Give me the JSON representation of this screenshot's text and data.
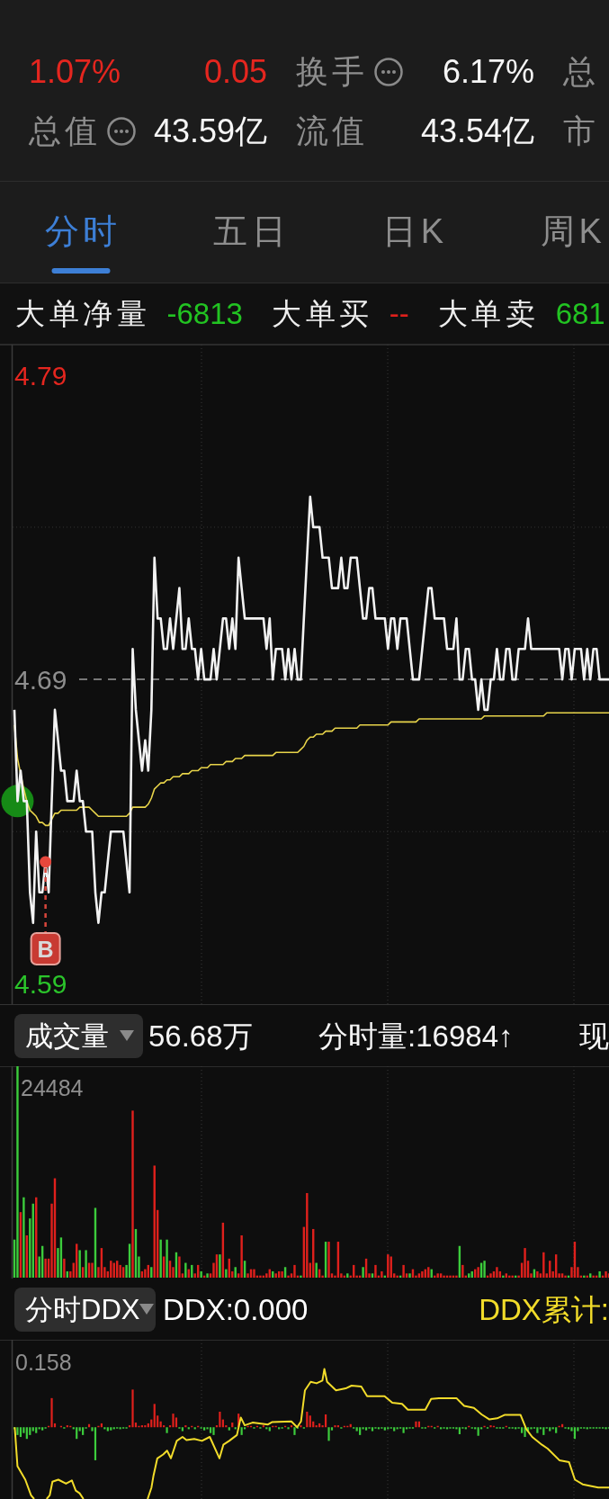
{
  "quote": {
    "change_percent": "1.07%",
    "change": "0.05"
  },
  "stats": [
    {
      "label": "换手",
      "info": true,
      "value": "6.17%"
    },
    {
      "label": "总",
      "info": false
    },
    {
      "label": "总值",
      "info": true,
      "value": "43.59亿"
    },
    {
      "label": "流值",
      "info": false,
      "value": "43.54亿"
    },
    {
      "label": "市",
      "info": false
    }
  ],
  "tabs": [
    {
      "label": "分时",
      "selected": true
    },
    {
      "label": "五日",
      "selected": false
    },
    {
      "label": "日K",
      "selected": false
    },
    {
      "label": "周K",
      "selected": false
    }
  ],
  "big_orders": [
    {
      "label": "大单净量",
      "value": "-6813",
      "color": "#22c322"
    },
    {
      "label": "大单买",
      "value": "--",
      "color": "#e0201c"
    },
    {
      "label": "大单卖",
      "value": "681",
      "color": "#22c322"
    }
  ],
  "price_chart": {
    "chart_data": {
      "type": "line",
      "categories": [
        null,
        null,
        null,
        null,
        null,
        null,
        null,
        null,
        null,
        null,
        null,
        null,
        null,
        null,
        null,
        null,
        null,
        null,
        null,
        null,
        null,
        null,
        null,
        null,
        null,
        null,
        null,
        null,
        null,
        null,
        null,
        null,
        null,
        null,
        null,
        null,
        null,
        null,
        null,
        null,
        null,
        null,
        null,
        null,
        null,
        null,
        null,
        null,
        null,
        null,
        null,
        null,
        null,
        null,
        null,
        null,
        null,
        null,
        null,
        null,
        null,
        null,
        null,
        null,
        null,
        null,
        null,
        null,
        null,
        null,
        null,
        null,
        null,
        null,
        null,
        null,
        null,
        null,
        null,
        null,
        null,
        null,
        null,
        null,
        null,
        null,
        null,
        null,
        null,
        null,
        null,
        null,
        null,
        null,
        null,
        null,
        null,
        null,
        null,
        null,
        null,
        null,
        null,
        null,
        null,
        null,
        null,
        null,
        null,
        null,
        null,
        null,
        null,
        null,
        null,
        null,
        null,
        null,
        null,
        null,
        null,
        null,
        null,
        null,
        null,
        null,
        null,
        null,
        null,
        null,
        null,
        null,
        null,
        null,
        null,
        null,
        null,
        null,
        null,
        null,
        null,
        null,
        null,
        null,
        null,
        null,
        null,
        null,
        null,
        null,
        null,
        null,
        null,
        null,
        null,
        null,
        null,
        null,
        null,
        null,
        null,
        null,
        null,
        null,
        null,
        null,
        null,
        null,
        null,
        null,
        null,
        null,
        null,
        null,
        null,
        null,
        null,
        null,
        null,
        null,
        null,
        null,
        null,
        null,
        null,
        null,
        null,
        null,
        null,
        null,
        null,
        null
      ],
      "ylim": [
        4.583,
        4.8
      ],
      "yticks": [
        {
          "value": 4.79,
          "label": "4.79"
        },
        {
          "value": 4.69,
          "label": "4.69"
        },
        {
          "value": 4.59,
          "label": "4.59"
        }
      ],
      "ref_lines": [
        {
          "axis": "y",
          "value": 4.74
        },
        {
          "axis": "y",
          "value": 4.69
        },
        {
          "axis": "y",
          "value": 4.64
        }
      ],
      "series": [
        {
          "color": "#f2f2f2",
          "values": [
            4.68,
            4.65,
            4.66,
            4.65,
            4.65,
            4.62,
            4.61,
            4.64,
            4.62,
            4.62,
            4.63,
            4.62,
            4.65,
            4.68,
            4.67,
            4.66,
            4.66,
            4.65,
            4.65,
            4.65,
            4.66,
            4.65,
            4.65,
            4.64,
            4.64,
            4.64,
            4.62,
            4.61,
            4.62,
            4.62,
            4.63,
            4.64,
            4.64,
            4.64,
            4.64,
            4.64,
            4.63,
            4.62,
            4.7,
            4.68,
            4.67,
            4.66,
            4.67,
            4.66,
            4.68,
            4.73,
            4.71,
            4.71,
            4.7,
            4.7,
            4.71,
            4.7,
            4.71,
            4.72,
            4.7,
            4.7,
            4.71,
            4.7,
            4.7,
            4.69,
            4.7,
            4.69,
            4.69,
            4.69,
            4.7,
            4.69,
            4.7,
            4.71,
            4.71,
            4.7,
            4.71,
            4.7,
            4.73,
            4.72,
            4.71,
            4.71,
            4.71,
            4.71,
            4.71,
            4.71,
            4.71,
            4.7,
            4.71,
            4.69,
            4.7,
            4.7,
            4.7,
            4.69,
            4.7,
            4.69,
            4.7,
            4.69,
            4.69,
            4.71,
            4.73,
            4.75,
            4.74,
            4.74,
            4.74,
            4.73,
            4.73,
            4.73,
            4.72,
            4.72,
            4.72,
            4.73,
            4.72,
            4.72,
            4.73,
            4.73,
            4.73,
            4.72,
            4.71,
            4.71,
            4.72,
            4.72,
            4.71,
            4.71,
            4.71,
            4.71,
            4.7,
            4.71,
            4.71,
            4.7,
            4.71,
            4.71,
            4.71,
            4.7,
            4.69,
            4.69,
            4.69,
            4.7,
            4.71,
            4.72,
            4.72,
            4.71,
            4.71,
            4.71,
            4.71,
            4.7,
            4.7,
            4.7,
            4.71,
            4.69,
            4.69,
            4.7,
            4.7,
            4.69,
            4.69,
            4.68,
            4.69,
            4.68,
            4.68,
            4.69,
            4.69,
            4.7,
            4.69,
            4.69,
            4.7,
            4.7,
            4.69,
            4.69,
            4.7,
            4.7,
            4.7,
            4.71,
            4.7,
            4.7,
            4.7,
            4.7,
            4.7,
            4.7,
            4.7,
            4.7,
            4.7,
            4.7,
            4.69,
            4.7,
            4.7,
            4.69,
            4.7,
            4.7,
            4.7,
            4.69,
            4.7,
            4.69,
            4.7,
            4.7,
            4.69,
            4.69,
            4.69,
            4.69
          ]
        },
        {
          "color": "#e8d44a",
          "values": [
            4.675,
            4.664,
            4.659,
            4.654,
            4.65,
            4.647,
            4.646,
            4.645,
            4.643,
            4.643,
            4.642,
            4.642,
            4.644,
            4.646,
            4.646,
            4.647,
            4.647,
            4.647,
            4.647,
            4.647,
            4.647,
            4.648,
            4.648,
            4.648,
            4.648,
            4.647,
            4.646,
            4.645,
            4.645,
            4.645,
            4.645,
            4.645,
            4.645,
            4.645,
            4.645,
            4.645,
            4.645,
            4.646,
            4.648,
            4.648,
            4.648,
            4.648,
            4.648,
            4.649,
            4.651,
            4.654,
            4.655,
            4.656,
            4.656,
            4.657,
            4.657,
            4.658,
            4.658,
            4.658,
            4.659,
            4.659,
            4.659,
            4.66,
            4.66,
            4.66,
            4.661,
            4.661,
            4.661,
            4.662,
            4.662,
            4.662,
            4.662,
            4.662,
            4.663,
            4.663,
            4.663,
            4.664,
            4.664,
            4.664,
            4.665,
            4.665,
            4.665,
            4.665,
            4.665,
            4.665,
            4.665,
            4.665,
            4.665,
            4.665,
            4.666,
            4.666,
            4.666,
            4.666,
            4.666,
            4.666,
            4.666,
            4.666,
            4.667,
            4.668,
            4.67,
            4.671,
            4.671,
            4.672,
            4.672,
            4.672,
            4.673,
            4.673,
            4.673,
            4.674,
            4.674,
            4.674,
            4.674,
            4.674,
            4.674,
            4.674,
            4.674,
            4.675,
            4.675,
            4.675,
            4.675,
            4.675,
            4.675,
            4.675,
            4.675,
            4.675,
            4.675,
            4.676,
            4.676,
            4.676,
            4.676,
            4.676,
            4.676,
            4.676,
            4.676,
            4.676,
            4.677,
            4.677,
            4.677,
            4.677,
            4.677,
            4.677,
            4.677,
            4.677,
            4.677,
            4.677,
            4.677,
            4.677,
            4.677,
            4.677,
            4.677,
            4.677,
            4.677,
            4.677,
            4.677,
            4.677,
            4.677,
            4.678,
            4.678,
            4.678,
            4.678,
            4.678,
            4.678,
            4.678,
            4.678,
            4.678,
            4.678,
            4.678,
            4.678,
            4.678,
            4.678,
            4.678,
            4.678,
            4.678,
            4.678,
            4.678,
            4.678,
            4.679,
            4.679,
            4.679,
            4.679,
            4.679,
            4.679,
            4.679,
            4.679,
            4.679,
            4.679,
            4.679,
            4.679,
            4.679,
            4.679,
            4.679,
            4.679,
            4.679,
            4.679,
            4.679,
            4.679,
            4.679
          ]
        }
      ]
    },
    "signal_label": "B"
  },
  "volume_panel": {
    "selector": "成交量",
    "readings": [
      "56.68万",
      "分时量:16984↑",
      "现"
    ],
    "max_label": "24484"
  },
  "ddx_panel": {
    "selector": "分时DDX",
    "readings": [
      {
        "text": "DDX:0.000",
        "color": "#ffffff"
      },
      {
        "text": "DDX累计:",
        "color": "#f2dc2a"
      }
    ],
    "max_label": "0.158"
  }
}
